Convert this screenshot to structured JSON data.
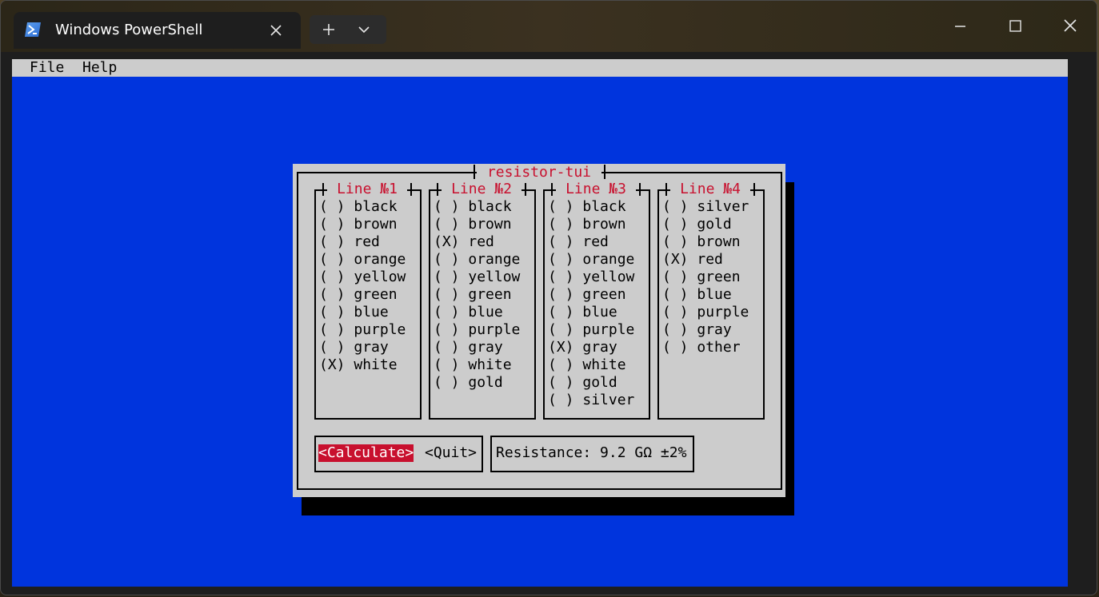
{
  "window": {
    "tab_title": "Windows PowerShell",
    "icons": {
      "app": "powershell-icon",
      "tab_close": "close-icon",
      "new_tab": "plus-icon",
      "dropdown": "chevron-down-icon",
      "minimize": "minimize-icon",
      "maximize": "maximize-icon",
      "close": "close-icon"
    }
  },
  "menubar": {
    "file": "File",
    "help": "Help"
  },
  "dialog": {
    "title": "resistor-tui",
    "groups": [
      {
        "label": "Line №1",
        "options": [
          {
            "mark": "( )",
            "label": "black"
          },
          {
            "mark": "( )",
            "label": "brown"
          },
          {
            "mark": "( )",
            "label": "red"
          },
          {
            "mark": "( )",
            "label": "orange"
          },
          {
            "mark": "( )",
            "label": "yellow"
          },
          {
            "mark": "( )",
            "label": "green"
          },
          {
            "mark": "( )",
            "label": "blue"
          },
          {
            "mark": "( )",
            "label": "purple"
          },
          {
            "mark": "( )",
            "label": "gray"
          },
          {
            "mark": "(X)",
            "label": "white"
          }
        ]
      },
      {
        "label": "Line №2",
        "options": [
          {
            "mark": "( )",
            "label": "black"
          },
          {
            "mark": "( )",
            "label": "brown"
          },
          {
            "mark": "(X)",
            "label": "red"
          },
          {
            "mark": "( )",
            "label": "orange"
          },
          {
            "mark": "( )",
            "label": "yellow"
          },
          {
            "mark": "( )",
            "label": "green"
          },
          {
            "mark": "( )",
            "label": "blue"
          },
          {
            "mark": "( )",
            "label": "purple"
          },
          {
            "mark": "( )",
            "label": "gray"
          },
          {
            "mark": "( )",
            "label": "white"
          },
          {
            "mark": "( )",
            "label": "gold"
          }
        ]
      },
      {
        "label": "Line №3",
        "options": [
          {
            "mark": "( )",
            "label": "black"
          },
          {
            "mark": "( )",
            "label": "brown"
          },
          {
            "mark": "( )",
            "label": "red"
          },
          {
            "mark": "( )",
            "label": "orange"
          },
          {
            "mark": "( )",
            "label": "yellow"
          },
          {
            "mark": "( )",
            "label": "green"
          },
          {
            "mark": "( )",
            "label": "blue"
          },
          {
            "mark": "( )",
            "label": "purple"
          },
          {
            "mark": "(X)",
            "label": "gray"
          },
          {
            "mark": "( )",
            "label": "white"
          },
          {
            "mark": "( )",
            "label": "gold"
          },
          {
            "mark": "( )",
            "label": "silver"
          }
        ]
      },
      {
        "label": "Line №4",
        "options": [
          {
            "mark": "( )",
            "label": "silver"
          },
          {
            "mark": "( )",
            "label": "gold"
          },
          {
            "mark": "( )",
            "label": "brown"
          },
          {
            "mark": "(X)",
            "label": "red"
          },
          {
            "mark": "( )",
            "label": "green"
          },
          {
            "mark": "( )",
            "label": "blue"
          },
          {
            "mark": "( )",
            "label": "purple"
          },
          {
            "mark": "( )",
            "label": "gray"
          },
          {
            "mark": "( )",
            "label": "other"
          }
        ]
      }
    ],
    "calculate_label": "<Calculate>",
    "quit_label": "<Quit>",
    "resistance_text": "Resistance: 9.2 GΩ ±2%"
  },
  "colors": {
    "terminal_bg": "#0034dd",
    "dialog_bg": "#cccccc",
    "accent": "#c8102e"
  }
}
